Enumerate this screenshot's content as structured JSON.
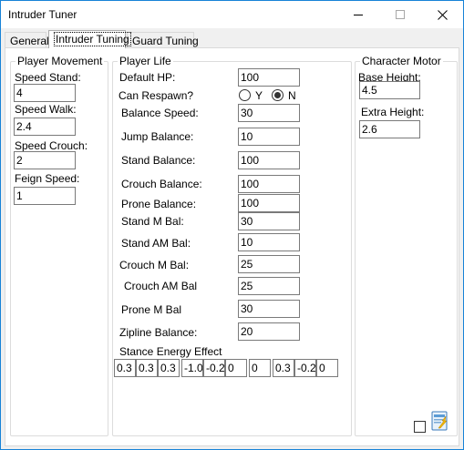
{
  "window": {
    "title": "Intruder Tuner"
  },
  "tabs": [
    {
      "label": "General"
    },
    {
      "label": "Intruder Tuning"
    },
    {
      "label": "Guard Tuning"
    }
  ],
  "player_movement": {
    "title": "Player Movement",
    "fields": [
      {
        "label": "Speed Stand:",
        "value": "4"
      },
      {
        "label": "Speed Walk:",
        "value": "2.4"
      },
      {
        "label": "Speed Crouch:",
        "value": "2"
      },
      {
        "label": "Feign Speed:",
        "value": "1"
      }
    ]
  },
  "player_life": {
    "title": "Player Life",
    "default_hp": {
      "label": "Default HP:",
      "value": "100"
    },
    "can_respawn": {
      "label": "Can Respawn?",
      "option_yes": "Y",
      "option_no": "N",
      "selected": "N"
    },
    "fields": [
      {
        "label": "Balance Speed:",
        "value": "30"
      },
      {
        "label": "Jump Balance:",
        "value": "10"
      },
      {
        "label": "Stand Balance:",
        "value": "100"
      },
      {
        "label": "Crouch Balance:",
        "value": "100"
      },
      {
        "label": "Prone Balance:",
        "value": "100"
      },
      {
        "label": "Stand M Bal:",
        "value": "30"
      },
      {
        "label": "Stand AM Bal:",
        "value": "10"
      },
      {
        "label": "Crouch M Bal:",
        "value": "25"
      },
      {
        "label": "Crouch AM Bal",
        "value": "25"
      },
      {
        "label": "Prone M Bal",
        "value": "30"
      },
      {
        "label": "Zipline Balance:",
        "value": "20"
      }
    ],
    "stance_energy": {
      "label": "Stance Energy Effect",
      "values": [
        "0.3",
        "0.3",
        "0.3",
        "-1.0",
        "-0.2",
        "0",
        "0",
        "0.3",
        "-0.2",
        "0"
      ]
    }
  },
  "character_motor": {
    "title": "Character Motor",
    "fields": [
      {
        "label": "Base Height:",
        "value": "4.5"
      },
      {
        "label": "Extra Height:",
        "value": "2.6"
      }
    ]
  },
  "footer": {
    "deploy_icon": "deploy-icon"
  }
}
